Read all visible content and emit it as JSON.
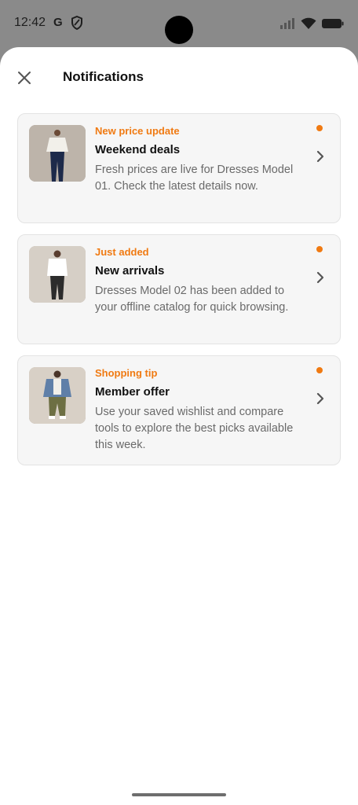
{
  "status_bar": {
    "time": "12:42",
    "g_icon": "G",
    "icons_left": [
      "google-g-icon",
      "shield-icon"
    ],
    "icons_right": [
      "signal-icon",
      "wifi-icon",
      "battery-icon"
    ]
  },
  "header": {
    "title": "Notifications",
    "close_icon": "close-icon"
  },
  "colors": {
    "accent": "#f07a12",
    "scrim": "#8a8a8a",
    "card_bg": "#f6f6f6"
  },
  "notifications": [
    {
      "tag": "New price update",
      "title": "Weekend deals",
      "body": "Fresh prices are live for Dresses Model 01. Check the latest details now.",
      "unread": true,
      "image_icon": "product-photo-white-shirt-navy-trousers"
    },
    {
      "tag": "Just added",
      "title": "New arrivals",
      "body": "Dresses Model 02 has been added to your offline catalog for quick browsing.",
      "unread": true,
      "image_icon": "product-photo-white-shirt-dark-trousers"
    },
    {
      "tag": "Shopping tip",
      "title": "Member offer",
      "body": "Use your saved wishlist and compare tools to explore the best picks available this week.",
      "unread": true,
      "image_icon": "product-photo-denim-jacket-olive-pants"
    }
  ]
}
